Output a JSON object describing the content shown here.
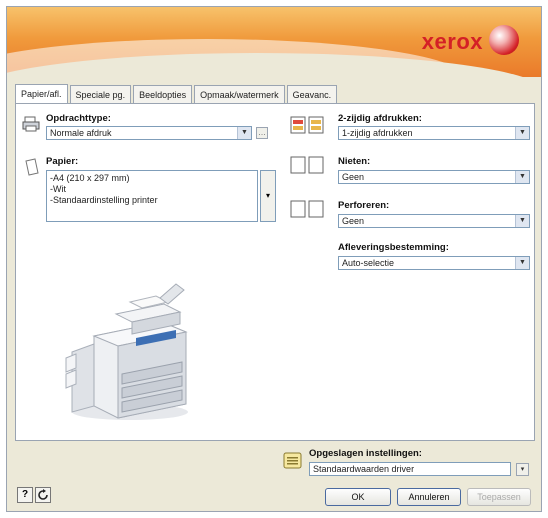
{
  "brand": {
    "name": "xerox"
  },
  "tabs": [
    "Papier/afl.",
    "Speciale pg.",
    "Beeldopties",
    "Opmaak/watermerk",
    "Geavanc."
  ],
  "job_type": {
    "label": "Opdrachttype:",
    "value": "Normale afdruk"
  },
  "paper": {
    "label": "Papier:",
    "lines": [
      "-A4 (210 x 297 mm)",
      "-Wit",
      "-Standaardinstelling printer"
    ]
  },
  "duplex": {
    "label": "2-zijdig afdrukken:",
    "value": "1-zijdig afdrukken"
  },
  "stapling": {
    "label": "Nieten:",
    "value": "Geen"
  },
  "punching": {
    "label": "Perforeren:",
    "value": "Geen"
  },
  "output_destination": {
    "label": "Afleveringsbestemming:",
    "value": "Auto-selectie"
  },
  "saved_settings": {
    "label": "Opgeslagen instellingen:",
    "value": "Standaardwaarden driver"
  },
  "buttons": {
    "help": "?",
    "ok": "OK",
    "cancel": "Annuleren",
    "apply": "Toepassen"
  },
  "colors": {
    "brand_red": "#d42026",
    "banner_orange": "#f09a3c"
  }
}
